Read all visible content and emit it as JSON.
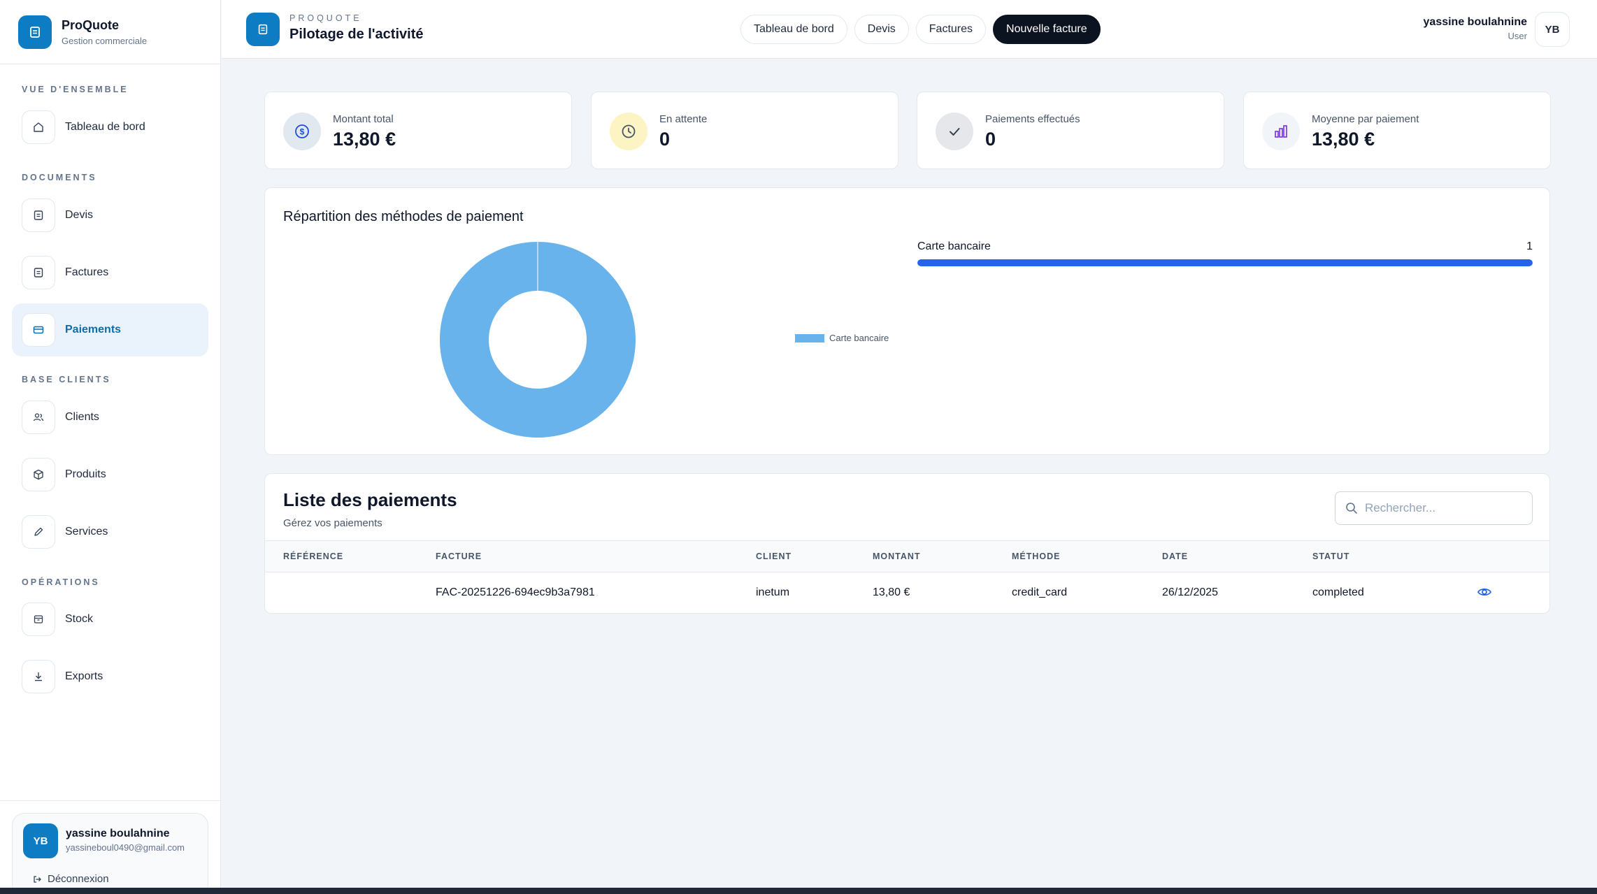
{
  "brand": {
    "name": "ProQuote",
    "subtitle": "Gestion commerciale"
  },
  "sidebar": {
    "sections": [
      {
        "label": "VUE D'ENSEMBLE"
      },
      {
        "label": "DOCUMENTS"
      },
      {
        "label": "BASE CLIENTS"
      },
      {
        "label": "OPÉRATIONS"
      }
    ],
    "items": [
      {
        "label": "Tableau de bord",
        "icon": "home-icon"
      },
      {
        "label": "Devis",
        "icon": "document-icon"
      },
      {
        "label": "Factures",
        "icon": "document-icon"
      },
      {
        "label": "Paiements",
        "icon": "credit-card-icon",
        "active": true
      },
      {
        "label": "Clients",
        "icon": "users-icon"
      },
      {
        "label": "Produits",
        "icon": "box-icon"
      },
      {
        "label": "Services",
        "icon": "pencil-icon"
      },
      {
        "label": "Stock",
        "icon": "archive-icon"
      },
      {
        "label": "Exports",
        "icon": "download-icon"
      }
    ],
    "user": {
      "initials": "YB",
      "name": "yassine boulahnine",
      "email": "yassineboul0490@gmail.com",
      "logout_label": "Déconnexion"
    }
  },
  "header": {
    "eyebrow": "PROQUOTE",
    "title": "Pilotage de l'activité",
    "tabs": [
      "Tableau de bord",
      "Devis",
      "Factures",
      "Nouvelle facture"
    ],
    "user": {
      "name": "yassine boulahnine",
      "role": "User",
      "initials": "YB"
    }
  },
  "stats": [
    {
      "label": "Montant total",
      "value": "13,80 €",
      "icon": "dollar-circle-icon"
    },
    {
      "label": "En attente",
      "value": "0",
      "icon": "clock-icon"
    },
    {
      "label": "Paiements effectués",
      "value": "0",
      "icon": "check-icon"
    },
    {
      "label": "Moyenne par paiement",
      "value": "13,80 €",
      "icon": "bar-chart-icon"
    }
  ],
  "chart_data": {
    "type": "pie",
    "title": "Répartition des méthodes de paiement",
    "categories": [
      "Carte bancaire"
    ],
    "values": [
      1
    ],
    "colors": [
      "#68b3ec"
    ],
    "legend": "right",
    "breakdown": [
      {
        "label": "Carte bancaire",
        "value": 1,
        "share": 1.0,
        "color": "#2463eb"
      }
    ]
  },
  "payments": {
    "title": "Liste des paiements",
    "subtitle": "Gérez vos paiements",
    "search_placeholder": "Rechercher...",
    "columns": [
      "RÉFÉRENCE",
      "FACTURE",
      "CLIENT",
      "MONTANT",
      "MÉTHODE",
      "DATE",
      "STATUT"
    ],
    "rows": [
      {
        "reference": "",
        "facture": "FAC-20251226-694ec9b3a7981",
        "client": "inetum",
        "montant": "13,80 €",
        "methode": "credit_card",
        "date": "26/12/2025",
        "statut": "completed"
      }
    ]
  }
}
